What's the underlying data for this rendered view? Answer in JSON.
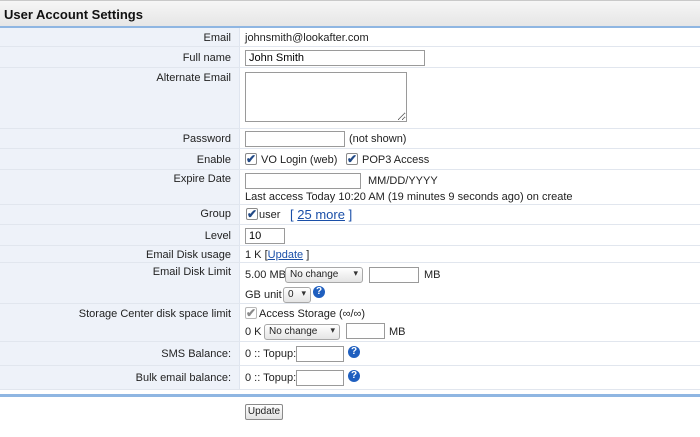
{
  "header": {
    "title": "User Account Settings"
  },
  "email": {
    "label": "Email",
    "value": "johnsmith@lookafter.com"
  },
  "full_name": {
    "label": "Full name",
    "value": "John Smith"
  },
  "alternate_email": {
    "label": "Alternate Email",
    "value": ""
  },
  "password": {
    "label": "Password",
    "value": "",
    "note": "(not shown)"
  },
  "enable": {
    "label": "Enable",
    "vo_login": {
      "label": "VO Login (web)",
      "checked": true
    },
    "pop3": {
      "label": "POP3 Access",
      "checked": true
    }
  },
  "expire_date": {
    "label": "Expire Date",
    "value": "",
    "format": "MM/DD/YYYY",
    "last_access": "Last access Today 10:20 AM (19 minutes 9 seconds ago) on create"
  },
  "group": {
    "label": "Group",
    "checkbox_label": "user",
    "checked": true,
    "more_open": "[",
    "more_link": "25 more",
    "more_close": "]"
  },
  "level": {
    "label": "Level",
    "value": "10"
  },
  "email_disk_usage": {
    "label": "Email Disk usage",
    "value": "1 K",
    "bracket_open": "[",
    "update_link": "Update",
    "bracket_close": "]"
  },
  "email_disk_limit": {
    "label": "Email Disk Limit",
    "current": "5.00 MB",
    "select": "No change",
    "amount": "",
    "unit": "MB",
    "gb_unit_label": "GB unit",
    "gb_unit_value": "0"
  },
  "storage_center": {
    "label": "Storage Center disk space limit",
    "access_label": "Access Storage",
    "access_checked": true,
    "access_value": "(∞/∞)",
    "current": "0 K",
    "select": "No change",
    "amount": "",
    "unit": "MB"
  },
  "sms_balance": {
    "label": "SMS Balance:",
    "prefix": "0 :: Topup:",
    "value": ""
  },
  "bulk_email_balance": {
    "label": "Bulk email balance:",
    "prefix": "0 :: Topup:",
    "value": ""
  },
  "icons": {
    "help": "?",
    "check": "✔",
    "dropdown": "▾"
  },
  "footer": {
    "update_button": "Update"
  },
  "colors": {
    "accent": "#8fb6e2",
    "label_bg": "#eef2f9",
    "link": "#1a4fa8",
    "help_icon": "#1f5fbf"
  }
}
